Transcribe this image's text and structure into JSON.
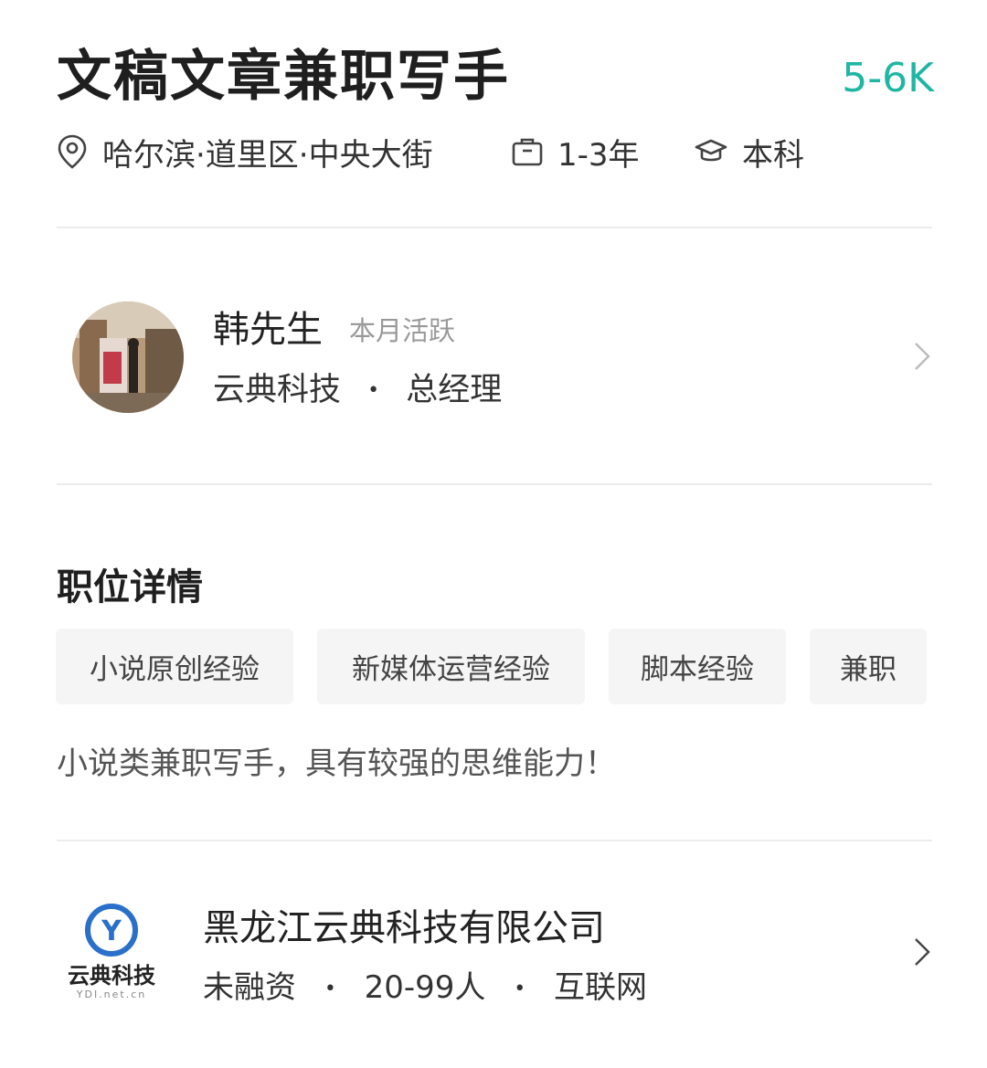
{
  "job": {
    "title": "文稿文章兼职写手",
    "salary": "5-6K",
    "location": "哈尔滨·道里区·中央大街",
    "experience": "1-3年",
    "education": "本科",
    "icons": {
      "location": "location-pin-icon",
      "experience": "briefcase-icon",
      "education": "graduation-cap-icon"
    }
  },
  "recruiter": {
    "name": "韩先生",
    "status": "本月活跃",
    "company_short": "云典科技",
    "separator": "•",
    "position": "总经理",
    "chevron": "chevron-right-icon"
  },
  "details": {
    "section_title": "职位详情",
    "tags": [
      "小说原创经验",
      "新媒体运营经验",
      "脚本经验",
      "兼职"
    ],
    "description": "小说类兼职写手，具有较强的思维能力！"
  },
  "company": {
    "name": "黑龙江云典科技有限公司",
    "funding": "未融资",
    "size": "20-99人",
    "industry": "互联网",
    "separator": "•",
    "logo_text": "云典科技",
    "logo_subtext": "YDI.net.cn",
    "logo_mark": "Y",
    "chevron": "chevron-right-icon"
  },
  "colors": {
    "salary": "#1fb6a4",
    "logo_blue": "#2a6fc9",
    "tag_bg": "#f5f5f5"
  }
}
